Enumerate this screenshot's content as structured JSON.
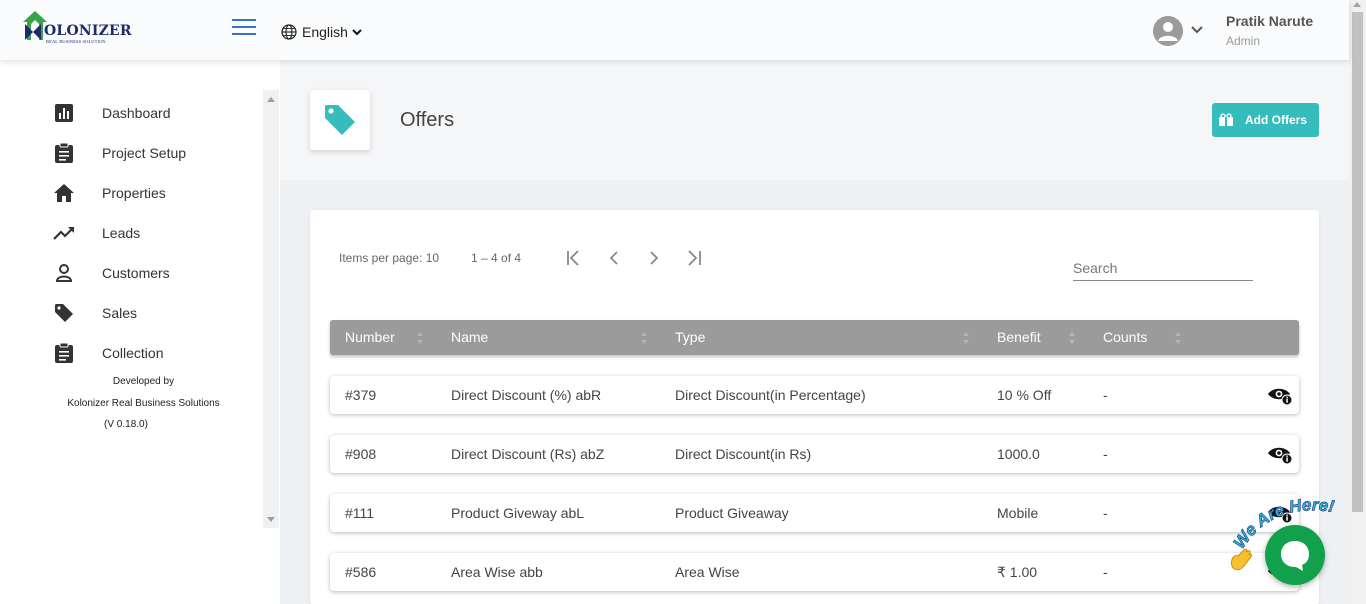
{
  "header": {
    "logo_text": "OLONIZER",
    "logo_tagline": "REAL BUSINESS SOLUTION",
    "language": "English",
    "user_name": "Pratik Narute",
    "user_role": "Admin"
  },
  "sidebar": {
    "items": [
      {
        "label": "Dashboard",
        "icon": "dashboard-icon"
      },
      {
        "label": "Project Setup",
        "icon": "clipboard-icon"
      },
      {
        "label": "Properties",
        "icon": "home-icon"
      },
      {
        "label": "Leads",
        "icon": "trending-up-icon"
      },
      {
        "label": "Customers",
        "icon": "person-icon"
      },
      {
        "label": "Sales",
        "icon": "tag-icon"
      },
      {
        "label": "Collection",
        "icon": "clipboard-icon"
      }
    ],
    "developed_by": "Developed by",
    "company": "Kolonizer Real Business Solutions",
    "version": "(V 0.18.0)"
  },
  "page": {
    "title": "Offers",
    "add_button": "Add Offers"
  },
  "table": {
    "items_per_page": "Items per page: 10",
    "range": "1 – 4 of 4",
    "search_placeholder": "Search",
    "columns": [
      "Number",
      "Name",
      "Type",
      "Benefit",
      "Counts"
    ],
    "rows": [
      {
        "number": "#379",
        "name": "Direct Discount (%) abR",
        "type": "Direct Discount(in Percentage)",
        "benefit": "10 % Off",
        "counts": "-"
      },
      {
        "number": "#908",
        "name": "Direct Discount (Rs) abZ",
        "type": "Direct Discount(in Rs)",
        "benefit": "1000.0",
        "counts": "-"
      },
      {
        "number": "#111",
        "name": "Product Giveway abL",
        "type": "Product Giveaway",
        "benefit": "Mobile",
        "counts": "-"
      },
      {
        "number": "#586",
        "name": "Area Wise abb",
        "type": "Area Wise",
        "benefit": "₹ 1.00",
        "counts": "-"
      }
    ]
  },
  "chat": {
    "banner": "We Are Here!"
  },
  "colors": {
    "accent": "#36bcbc",
    "header_row": "#9b9b9b",
    "chat": "#12a14b"
  }
}
